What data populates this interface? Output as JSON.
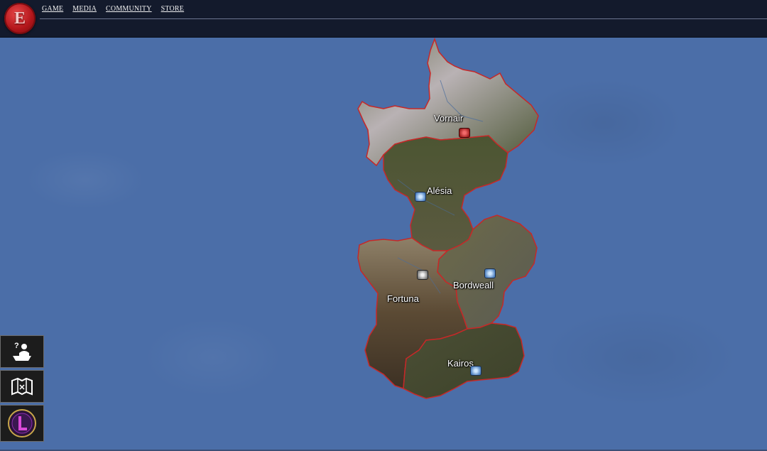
{
  "nav": {
    "items": [
      {
        "label": "GAME"
      },
      {
        "label": "MEDIA"
      },
      {
        "label": "COMMUNITY"
      },
      {
        "label": "STORE"
      }
    ]
  },
  "logo": {
    "glyph": "E"
  },
  "map": {
    "regions": [
      {
        "name": "Vornair",
        "marker": "red-shield-icon"
      },
      {
        "name": "Alésia",
        "marker": "blue-shield-icon"
      },
      {
        "name": "Bordweall",
        "marker": "blue-shield-icon"
      },
      {
        "name": "Fortuna",
        "marker": "gray-shield-icon"
      },
      {
        "name": "Kairos",
        "marker": "blue-shield-icon"
      }
    ]
  },
  "sidebar": {
    "buttons": [
      {
        "icon": "help-person-icon"
      },
      {
        "icon": "map-icon"
      },
      {
        "icon": "emblem-icon"
      }
    ]
  },
  "colors": {
    "sea": "#4b6ea8",
    "topbar": "#131a2c",
    "border_red": "#c62828",
    "marker_red": "#9d1c1c",
    "marker_blue": "#4b7fbf"
  }
}
